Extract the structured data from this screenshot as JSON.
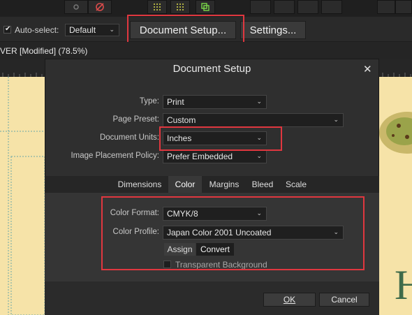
{
  "toolbar": {
    "icons": [
      "settings-icon",
      "gear-slash-icon",
      "grid-dots-icon",
      "grid-dots-icon",
      "layers-icon"
    ]
  },
  "context": {
    "autoselect_label": "Auto-select:",
    "autoselect_value": "Default",
    "document_setup_label": "Document Setup...",
    "settings_label": "Settings..."
  },
  "window": {
    "title": "VER [Modified] (78.5%)"
  },
  "dialog": {
    "title": "Document Setup",
    "close": "✕",
    "fields": {
      "type_label": "Type:",
      "type_value": "Print",
      "preset_label": "Page Preset:",
      "preset_value": "Custom",
      "units_label": "Document Units:",
      "units_value": "Inches",
      "placement_label": "Image Placement Policy:",
      "placement_value": "Prefer Embedded"
    },
    "tabs": [
      "Dimensions",
      "Color",
      "Margins",
      "Bleed",
      "Scale"
    ],
    "active_tab": "Color",
    "color": {
      "format_label": "Color Format:",
      "format_value": "CMYK/8",
      "profile_label": "Color Profile:",
      "profile_value": "Japan Color 2001 Uncoated",
      "assign_label": "Assign",
      "convert_label": "Convert",
      "transparent_label": "Transparent Background"
    },
    "ok_label": "OK",
    "cancel_label": "Cancel"
  },
  "colors": {
    "highlight": "#e0373f",
    "canvas": "#f6e3a8"
  }
}
